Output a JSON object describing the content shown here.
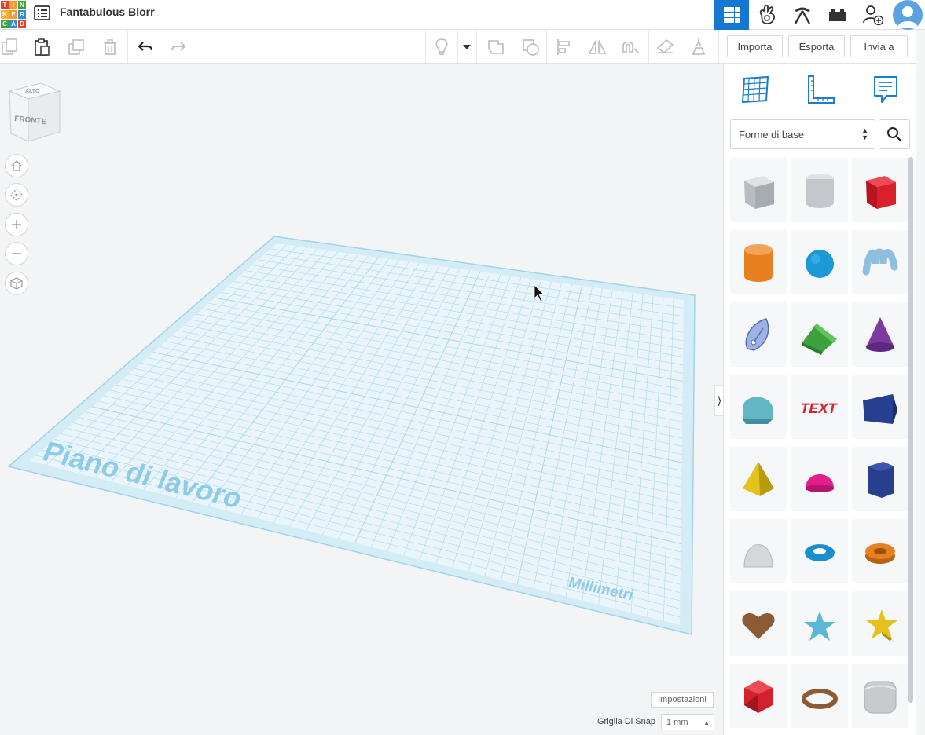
{
  "app": {
    "title": "Fantabulous Blorr",
    "logo_letters": [
      "T",
      "I",
      "N",
      "K",
      "E",
      "R",
      "C",
      "A",
      "D"
    ],
    "logo_colors": [
      "#e2412c",
      "#f79a2e",
      "#3ca43e",
      "#f7b030",
      "#f79a2e",
      "#2a8fd6",
      "#3ca43e",
      "#2a8fd6",
      "#e2412c"
    ]
  },
  "topbar_icons": [
    "grid-view-icon",
    "lego-brick-hand-icon",
    "pickaxe-icon",
    "lego-brick-icon",
    "add-user-icon",
    "avatar-icon"
  ],
  "toolbar": {
    "import_label": "Importa",
    "export_label": "Esporta",
    "send_label": "Invia a"
  },
  "workplane": {
    "label": "Piano di lavoro",
    "units": "Millimetri"
  },
  "viewcube": {
    "top": "ALTO",
    "front": "FRONTE"
  },
  "bottom": {
    "settings_label": "Impostazioni",
    "snap_label": "Griglia Di Snap",
    "snap_value": "1 mm"
  },
  "panel": {
    "category": "Forme di base",
    "shapes": [
      {
        "name": "box-hole",
        "color": "#b8bdc3"
      },
      {
        "name": "cylinder-hole",
        "color": "#c4c8cc"
      },
      {
        "name": "box",
        "color": "#d9202c"
      },
      {
        "name": "cylinder",
        "color": "#e9801f"
      },
      {
        "name": "sphere",
        "color": "#1b9ad8"
      },
      {
        "name": "scribble",
        "color": "#8fbfe0"
      },
      {
        "name": "shape-generator",
        "color": "#9cb3e6"
      },
      {
        "name": "roof",
        "color": "#3ba13c"
      },
      {
        "name": "cone",
        "color": "#7b3aa0"
      },
      {
        "name": "round-roof",
        "color": "#63b6c4"
      },
      {
        "name": "text",
        "color": "#d2232d"
      },
      {
        "name": "wedge",
        "color": "#263f8f"
      },
      {
        "name": "pyramid",
        "color": "#e6c21c"
      },
      {
        "name": "half-sphere",
        "color": "#e01e8e"
      },
      {
        "name": "polygon",
        "color": "#283f8e"
      },
      {
        "name": "paraboloid",
        "color": "#d5d7d9"
      },
      {
        "name": "torus",
        "color": "#1a8fd0"
      },
      {
        "name": "tube",
        "color": "#e8801e"
      },
      {
        "name": "heart",
        "color": "#8c5b34"
      },
      {
        "name": "star",
        "color": "#5ab7d6"
      },
      {
        "name": "star-3d",
        "color": "#e4c21b"
      },
      {
        "name": "icosahedron",
        "color": "#d2202c"
      },
      {
        "name": "ring",
        "color": "#8c5a33"
      },
      {
        "name": "rounded-box",
        "color": "#c8cbce"
      }
    ]
  }
}
